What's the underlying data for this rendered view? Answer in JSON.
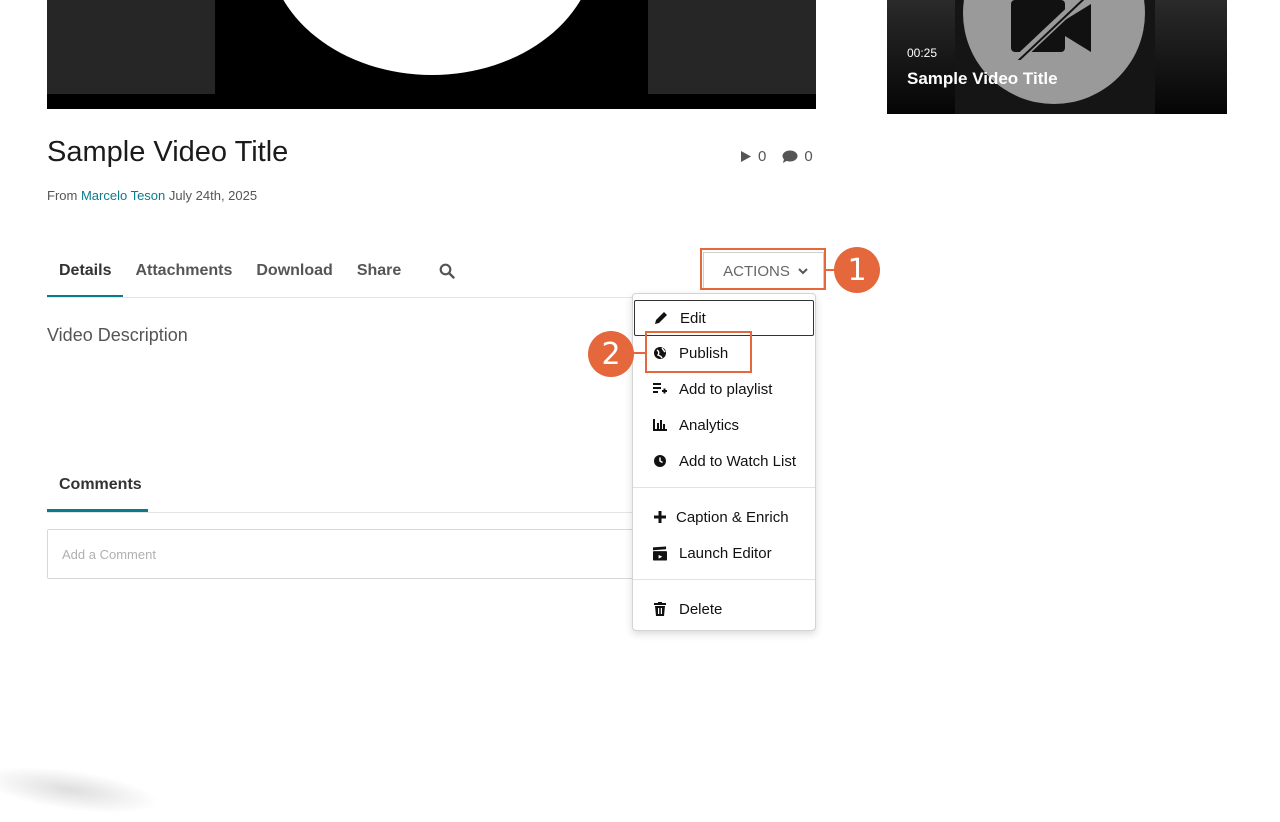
{
  "player": {},
  "related": {
    "duration": "00:25",
    "title": "Sample Video Title"
  },
  "video": {
    "title": "Sample Video Title",
    "plays": "0",
    "comments_count": "0",
    "from_label": "From",
    "author": "Marcelo Teson",
    "date": "July 24th, 2025"
  },
  "tabs": [
    {
      "label": "Details"
    },
    {
      "label": "Attachments"
    },
    {
      "label": "Download"
    },
    {
      "label": "Share"
    }
  ],
  "actions": {
    "label": "ACTIONS"
  },
  "description": "Video Description",
  "comments": {
    "tab_label": "Comments",
    "placeholder": "Add a Comment"
  },
  "menu": {
    "items": [
      {
        "label": "Edit",
        "icon": "pencil-icon"
      },
      {
        "label": "Publish",
        "icon": "globe-icon"
      },
      {
        "label": "Add to playlist",
        "icon": "playlist-add-icon"
      },
      {
        "label": "Analytics",
        "icon": "bar-chart-icon"
      },
      {
        "label": "Add to Watch List",
        "icon": "clock-icon"
      },
      {
        "label": "Caption & Enrich",
        "icon": "plus-icon"
      },
      {
        "label": "Launch Editor",
        "icon": "clapperboard-icon"
      },
      {
        "label": "Delete",
        "icon": "trash-icon"
      }
    ]
  },
  "callouts": [
    "1",
    "2"
  ],
  "colors": {
    "accent": "#0b7b8b",
    "callout": "#e4683c"
  }
}
